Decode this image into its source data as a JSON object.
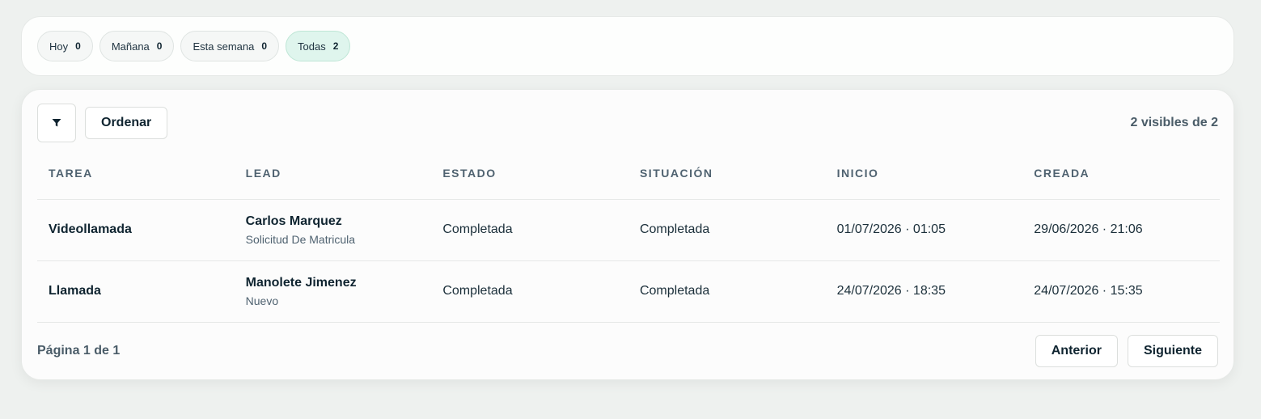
{
  "filters": [
    {
      "label": "Hoy",
      "count": "0"
    },
    {
      "label": "Mañana",
      "count": "0"
    },
    {
      "label": "Esta semana",
      "count": "0"
    },
    {
      "label": "Todas",
      "count": "2"
    }
  ],
  "toolbar": {
    "filter_icon": "filter-funnel-icon",
    "sort_label": "Ordenar",
    "visible_count": "2 visibles de 2"
  },
  "table": {
    "columns": [
      "TAREA",
      "LEAD",
      "ESTADO",
      "SITUACIÓN",
      "INICIO",
      "CREADA"
    ],
    "rows": [
      {
        "task": "Videollamada",
        "lead_name": "Carlos Marquez",
        "lead_sub": "Solicitud De Matricula",
        "estado": "Completada",
        "situacion": "Completada",
        "inicio": "01/07/2026 · 01:05",
        "creada": "29/06/2026 · 21:06"
      },
      {
        "task": "Llamada",
        "lead_name": "Manolete Jimenez",
        "lead_sub": "Nuevo",
        "estado": "Completada",
        "situacion": "Completada",
        "inicio": "24/07/2026 · 18:35",
        "creada": "24/07/2026 · 15:35"
      }
    ]
  },
  "pagination": {
    "info": "Página 1 de 1",
    "prev_label": "Anterior",
    "next_label": "Siguiente"
  },
  "colors": {
    "active_chip_bg": "#dff5ed",
    "text_dark": "#0f2430",
    "text_muted": "#4f6270"
  }
}
